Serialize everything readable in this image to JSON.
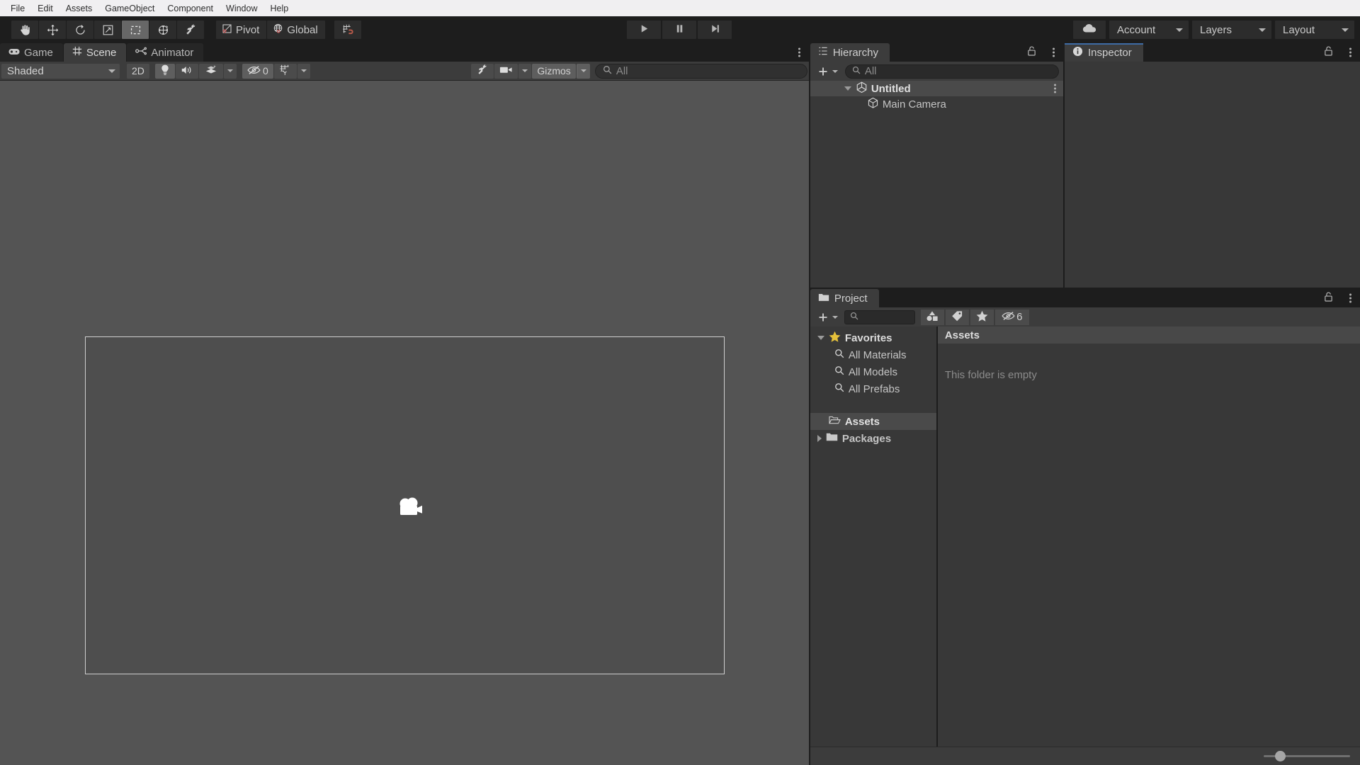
{
  "menubar": {
    "items": [
      "File",
      "Edit",
      "Assets",
      "GameObject",
      "Component",
      "Window",
      "Help"
    ]
  },
  "toolbar": {
    "tools": [
      {
        "name": "hand-tool",
        "label": "Hand Tool",
        "active": false
      },
      {
        "name": "move-tool",
        "label": "Move Tool",
        "active": false
      },
      {
        "name": "rotate-tool",
        "label": "Rotate Tool",
        "active": false
      },
      {
        "name": "scale-tool",
        "label": "Scale Tool",
        "active": false
      },
      {
        "name": "rect-tool",
        "label": "Rect Tool",
        "active": true
      },
      {
        "name": "transform-tool",
        "label": "Transform Tool",
        "active": false
      },
      {
        "name": "custom-editor-tool",
        "label": "Custom Tool",
        "active": false
      }
    ],
    "pivot_label": "Pivot",
    "handle_label": "Global",
    "snap_label": "Grid Snapping",
    "play_label": "Play",
    "pause_label": "Pause",
    "step_label": "Step",
    "cloud_label": "Unity Cloud",
    "account_label": "Account",
    "layers_label": "Layers",
    "layout_label": "Layout"
  },
  "scene_tabs": [
    {
      "label": "Game",
      "icon": "game-icon",
      "active": false
    },
    {
      "label": "Scene",
      "icon": "grid-icon",
      "active": true
    },
    {
      "label": "Animator",
      "icon": "bone-icon",
      "active": false
    }
  ],
  "scene_toolbar": {
    "draw_mode": "Shaded",
    "toggle_2d": "2D",
    "lighting_label": "Lighting",
    "audio_label": "Audio",
    "fx_label": "Effects",
    "hidden_count": "0",
    "grid_label": "Grid",
    "tools_label": "Scene Tools",
    "camera_label": "Scene Camera",
    "gizmos_label": "Gizmos",
    "search_placeholder": "All",
    "search_value": ""
  },
  "scene_view": {
    "camera_gizmo_name": "main-camera-gizmo",
    "frustum_border_color": "#cfcfcf",
    "background_color": "#545454"
  },
  "hierarchy": {
    "title": "Hierarchy",
    "add_label": "Create",
    "search_placeholder": "All",
    "search_value": "",
    "rows": [
      {
        "label": "Untitled",
        "icon": "unity-scene-icon",
        "depth": 0,
        "type": "scene",
        "expanded": true,
        "selected": true
      },
      {
        "label": "Main Camera",
        "icon": "gameobject-cube-icon",
        "depth": 1,
        "type": "gameobject",
        "expanded": false,
        "selected": false
      }
    ]
  },
  "inspector": {
    "title": "Inspector",
    "accent_color": "#3e6ba5",
    "body_text": ""
  },
  "project": {
    "title": "Project",
    "add_label": "Create",
    "search_placeholder": "",
    "search_value": "",
    "filter_type_label": "Search by Type",
    "filter_label_label": "Search by Label",
    "favorites_label": "Favorites",
    "hidden_packages_count": "6",
    "tree": [
      {
        "label": "Favorites",
        "icon": "star-icon",
        "depth": 0,
        "expanded": true,
        "selected": false
      },
      {
        "label": "All Materials",
        "icon": "search-icon",
        "depth": 1,
        "expanded": false,
        "selected": false
      },
      {
        "label": "All Models",
        "icon": "search-icon",
        "depth": 1,
        "expanded": false,
        "selected": false
      },
      {
        "label": "All Prefabs",
        "icon": "search-icon",
        "depth": 1,
        "expanded": false,
        "selected": false
      },
      {
        "label": "Assets",
        "icon": "folder-open-icon",
        "depth": 0,
        "expanded": false,
        "selected": true
      },
      {
        "label": "Packages",
        "icon": "folder-icon",
        "depth": 0,
        "expanded": false,
        "selected": false
      }
    ],
    "breadcrumb": "Assets",
    "empty_message": "This folder is empty",
    "zoom_slider_value": 18
  }
}
